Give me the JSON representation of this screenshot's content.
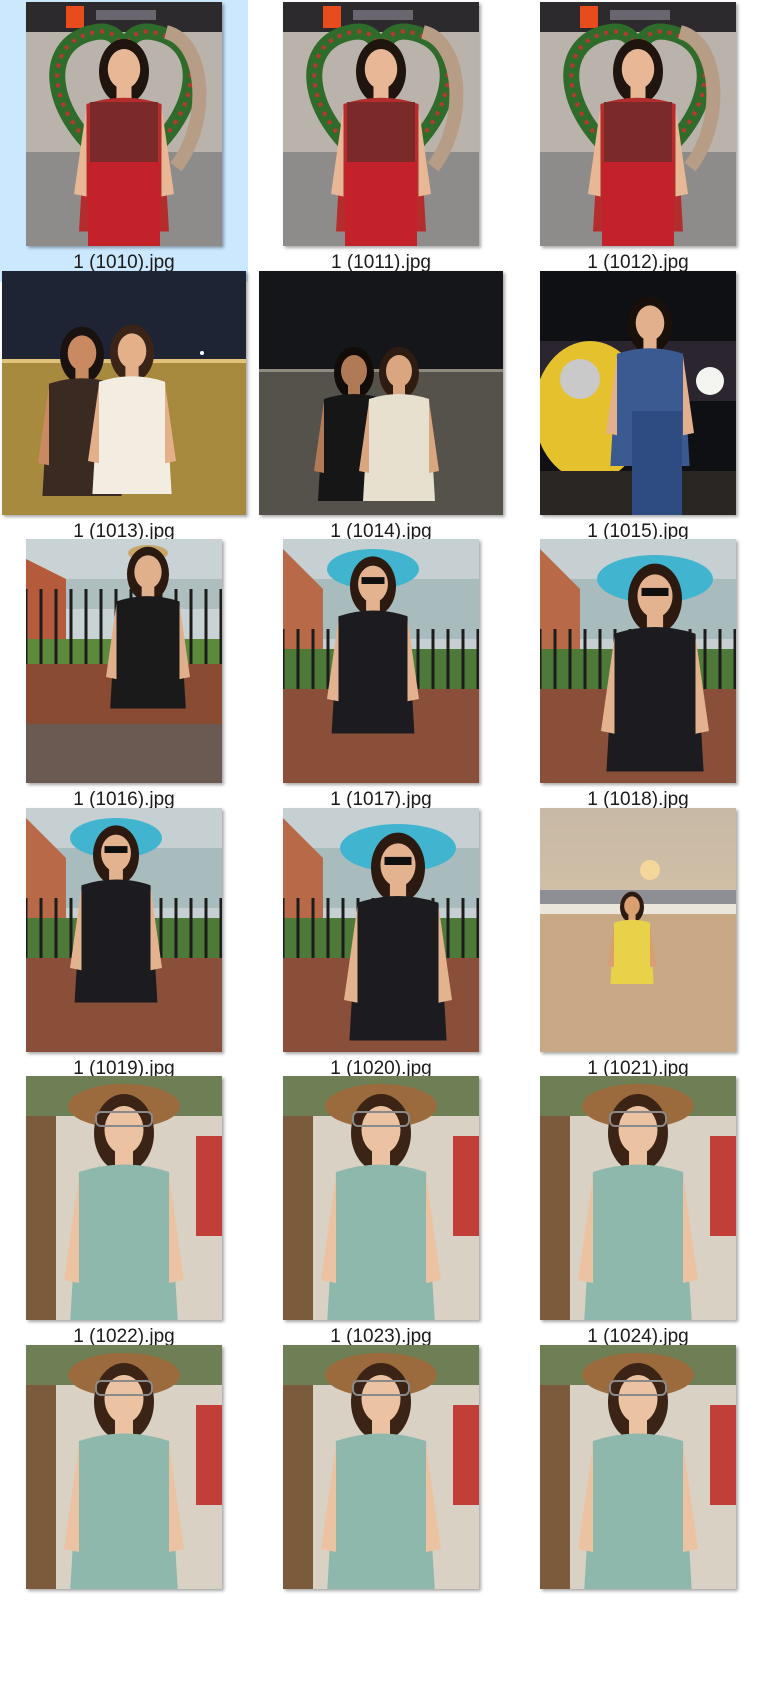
{
  "window": {
    "view": "large-icons",
    "selected_index": 0
  },
  "files": [
    {
      "name": "1 (1010).jpg",
      "scene": "heart-arch-mall",
      "shape": "portrait"
    },
    {
      "name": "1 (1011).jpg",
      "scene": "heart-arch-mall",
      "shape": "portrait"
    },
    {
      "name": "1 (1012).jpg",
      "scene": "heart-arch-mall",
      "shape": "portrait"
    },
    {
      "name": "1 (1013).jpg",
      "scene": "night-promenade-warm",
      "shape": "landscape"
    },
    {
      "name": "1 (1014).jpg",
      "scene": "night-promenade-cool",
      "shape": "landscape"
    },
    {
      "name": "1 (1015).jpg",
      "scene": "night-scooter-selfie",
      "shape": "portrait"
    },
    {
      "name": "1 (1016).jpg",
      "scene": "fort-wall-straw-hat",
      "shape": "portrait"
    },
    {
      "name": "1 (1017).jpg",
      "scene": "fort-wall-blue-hat",
      "shape": "portrait"
    },
    {
      "name": "1 (1018).jpg",
      "scene": "fort-wall-blue-hat-close",
      "shape": "portrait"
    },
    {
      "name": "1 (1019).jpg",
      "scene": "fort-wall-blue-hat",
      "shape": "portrait"
    },
    {
      "name": "1 (1020).jpg",
      "scene": "fort-wall-blue-hat-close",
      "shape": "portrait"
    },
    {
      "name": "1 (1021).jpg",
      "scene": "beach-sunset",
      "shape": "portrait"
    },
    {
      "name": "1 (1022).jpg",
      "scene": "cafe-brown-hat",
      "shape": "portrait"
    },
    {
      "name": "1 (1023).jpg",
      "scene": "cafe-brown-hat",
      "shape": "portrait"
    },
    {
      "name": "1 (1024).jpg",
      "scene": "cafe-brown-hat",
      "shape": "portrait"
    },
    {
      "name": "",
      "scene": "cafe-brown-hat",
      "shape": "portrait"
    },
    {
      "name": "",
      "scene": "cafe-brown-hat",
      "shape": "portrait"
    },
    {
      "name": "",
      "scene": "cafe-brown-hat",
      "shape": "portrait"
    }
  ],
  "colors": {
    "selection": "#cce8ff",
    "caption": "#1a1a1a"
  }
}
